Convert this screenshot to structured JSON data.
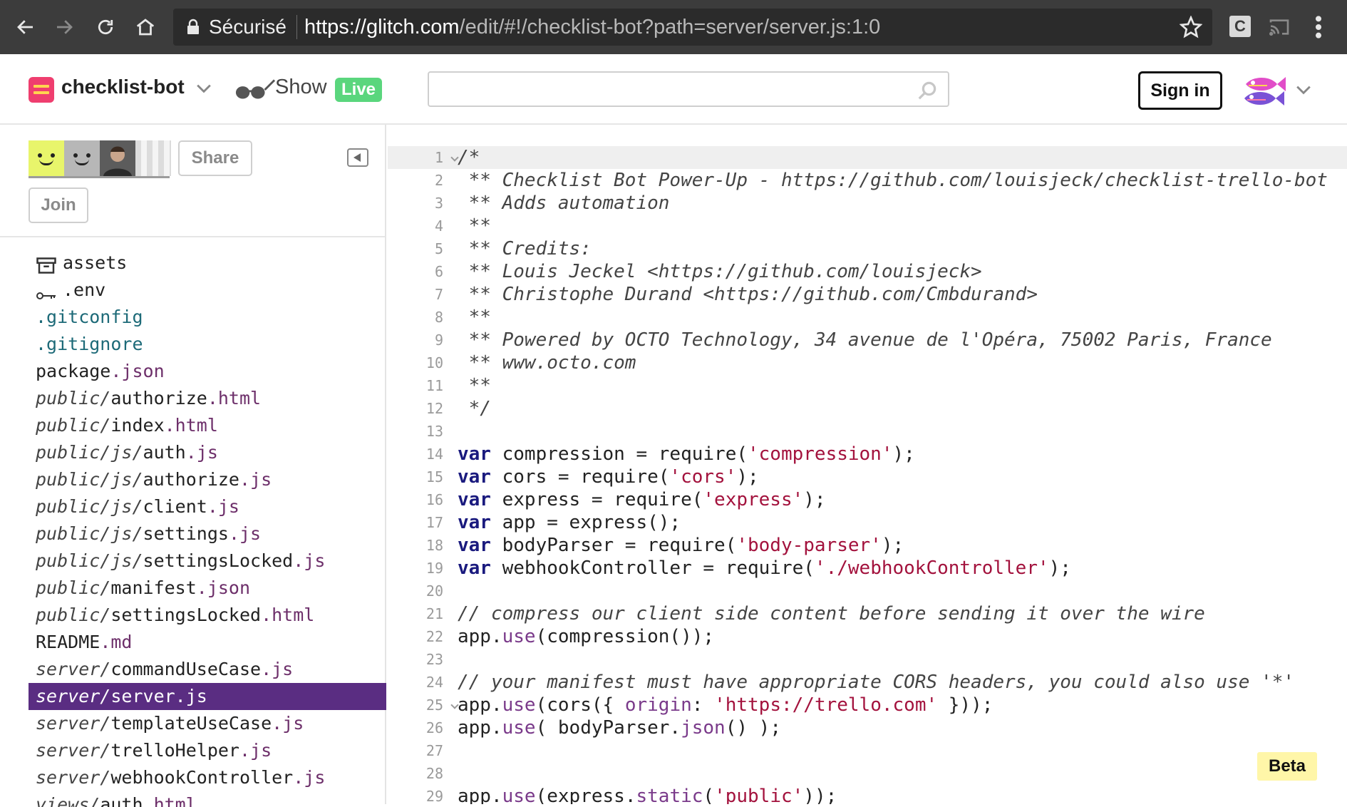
{
  "browser": {
    "secure_label": "Sécurisé",
    "url_host": "https://glitch.com",
    "url_path": "/edit/#!/checklist-bot?path=server/server.js:1:0",
    "extension_label": "C"
  },
  "header": {
    "project_name": "checklist-bot",
    "show_label": "Show",
    "live_badge": "Live",
    "search_placeholder": "",
    "signin_label": "Sign in"
  },
  "sidebar": {
    "share_label": "Share",
    "join_label": "Join",
    "files": [
      {
        "dir": "",
        "base": "assets",
        "ext": "",
        "icon": "archive-icon"
      },
      {
        "dir": "",
        "base": ".env",
        "ext": "",
        "icon": "key-icon"
      },
      {
        "dir": "",
        "base": ".gitconfig",
        "ext": "",
        "dotfile": true
      },
      {
        "dir": "",
        "base": ".gitignore",
        "ext": "",
        "dotfile": true
      },
      {
        "dir": "",
        "base": "package",
        "ext": ".json"
      },
      {
        "dir": "public/",
        "base": "authorize",
        "ext": ".html"
      },
      {
        "dir": "public/",
        "base": "index",
        "ext": ".html"
      },
      {
        "dir": "public/js/",
        "base": "auth",
        "ext": ".js"
      },
      {
        "dir": "public/js/",
        "base": "authorize",
        "ext": ".js"
      },
      {
        "dir": "public/js/",
        "base": "client",
        "ext": ".js"
      },
      {
        "dir": "public/js/",
        "base": "settings",
        "ext": ".js"
      },
      {
        "dir": "public/js/",
        "base": "settingsLocked",
        "ext": ".js"
      },
      {
        "dir": "public/",
        "base": "manifest",
        "ext": ".json"
      },
      {
        "dir": "public/",
        "base": "settingsLocked",
        "ext": ".html"
      },
      {
        "dir": "",
        "base": "README",
        "ext": ".md"
      },
      {
        "dir": "server/",
        "base": "commandUseCase",
        "ext": ".js"
      },
      {
        "dir": "server/",
        "base": "server",
        "ext": ".js",
        "selected": true
      },
      {
        "dir": "server/",
        "base": "templateUseCase",
        "ext": ".js"
      },
      {
        "dir": "server/",
        "base": "trelloHelper",
        "ext": ".js"
      },
      {
        "dir": "server/",
        "base": "webhookController",
        "ext": ".js"
      },
      {
        "dir": "views/",
        "base": "auth",
        "ext": ".html",
        "cut": true
      }
    ]
  },
  "editor": {
    "lines": [
      {
        "n": "1",
        "fold": true,
        "tokens": [
          [
            "cm",
            "/*"
          ]
        ]
      },
      {
        "n": "2",
        "tokens": [
          [
            "cm",
            " ** Checklist Bot Power-Up - https://github.com/louisjeck/checklist-trello-bot"
          ]
        ]
      },
      {
        "n": "3",
        "tokens": [
          [
            "cm",
            " ** Adds automation"
          ]
        ]
      },
      {
        "n": "4",
        "tokens": [
          [
            "cm",
            " **"
          ]
        ]
      },
      {
        "n": "5",
        "tokens": [
          [
            "cm",
            " ** Credits:"
          ]
        ]
      },
      {
        "n": "6",
        "tokens": [
          [
            "cm",
            " ** Louis Jeckel <https://github.com/louisjeck>"
          ]
        ]
      },
      {
        "n": "7",
        "tokens": [
          [
            "cm",
            " ** Christophe Durand <https://github.com/Cmbdurand>"
          ]
        ]
      },
      {
        "n": "8",
        "tokens": [
          [
            "cm",
            " **"
          ]
        ]
      },
      {
        "n": "9",
        "tokens": [
          [
            "cm",
            " ** Powered by OCTO Technology, 34 avenue de l'Opéra, 75002 Paris, France"
          ]
        ]
      },
      {
        "n": "10",
        "tokens": [
          [
            "cm",
            " ** www.octo.com"
          ]
        ]
      },
      {
        "n": "11",
        "tokens": [
          [
            "cm",
            " **"
          ]
        ]
      },
      {
        "n": "12",
        "tokens": [
          [
            "cm",
            " */"
          ]
        ]
      },
      {
        "n": "13",
        "tokens": []
      },
      {
        "n": "14",
        "tokens": [
          [
            "kw",
            "var"
          ],
          [
            "",
            " compression = require("
          ],
          [
            "str",
            "'compression'"
          ],
          [
            "",
            ");"
          ]
        ]
      },
      {
        "n": "15",
        "tokens": [
          [
            "kw",
            "var"
          ],
          [
            "",
            " cors = require("
          ],
          [
            "str",
            "'cors'"
          ],
          [
            "",
            ");"
          ]
        ]
      },
      {
        "n": "16",
        "tokens": [
          [
            "kw",
            "var"
          ],
          [
            "",
            " express = require("
          ],
          [
            "str",
            "'express'"
          ],
          [
            "",
            ");"
          ]
        ]
      },
      {
        "n": "17",
        "tokens": [
          [
            "kw",
            "var"
          ],
          [
            "",
            " app = express();"
          ]
        ]
      },
      {
        "n": "18",
        "tokens": [
          [
            "kw",
            "var"
          ],
          [
            "",
            " bodyParser = require("
          ],
          [
            "str",
            "'body-parser'"
          ],
          [
            "",
            ");"
          ]
        ]
      },
      {
        "n": "19",
        "tokens": [
          [
            "kw",
            "var"
          ],
          [
            "",
            " webhookController = require("
          ],
          [
            "str",
            "'./webhookController'"
          ],
          [
            "",
            ");"
          ]
        ]
      },
      {
        "n": "20",
        "tokens": []
      },
      {
        "n": "21",
        "tokens": [
          [
            "cm",
            "// compress our client side content before sending it over the wire"
          ]
        ]
      },
      {
        "n": "22",
        "tokens": [
          [
            "",
            "app."
          ],
          [
            "prop",
            "use"
          ],
          [
            "",
            "(compression());"
          ]
        ]
      },
      {
        "n": "23",
        "tokens": []
      },
      {
        "n": "24",
        "tokens": [
          [
            "cm",
            "// your manifest must have appropriate CORS headers, you could also use '*'"
          ]
        ]
      },
      {
        "n": "25",
        "fold": true,
        "tokens": [
          [
            "",
            "app."
          ],
          [
            "prop",
            "use"
          ],
          [
            "",
            "(cors({ "
          ],
          [
            "prop",
            "origin"
          ],
          [
            "",
            ": "
          ],
          [
            "str",
            "'https://trello.com'"
          ],
          [
            "",
            " }));"
          ]
        ]
      },
      {
        "n": "26",
        "tokens": [
          [
            "",
            "app."
          ],
          [
            "prop",
            "use"
          ],
          [
            "",
            "( bodyParser."
          ],
          [
            "prop",
            "json"
          ],
          [
            "",
            "() );"
          ]
        ]
      },
      {
        "n": "27",
        "tokens": []
      },
      {
        "n": "28",
        "tokens": []
      },
      {
        "n": "29",
        "tokens": [
          [
            "",
            "app."
          ],
          [
            "prop",
            "use"
          ],
          [
            "",
            "(express."
          ],
          [
            "prop",
            "static"
          ],
          [
            "",
            "("
          ],
          [
            "str",
            "'public'"
          ],
          [
            "",
            "));"
          ]
        ]
      }
    ],
    "beta_label": "Beta"
  },
  "colors": {
    "chrome": "#3c3c3c",
    "selected_file": "#5a2d82",
    "live": "#5ad67d",
    "project_logo": "#ef3e6f",
    "beta": "#fff6a8"
  }
}
